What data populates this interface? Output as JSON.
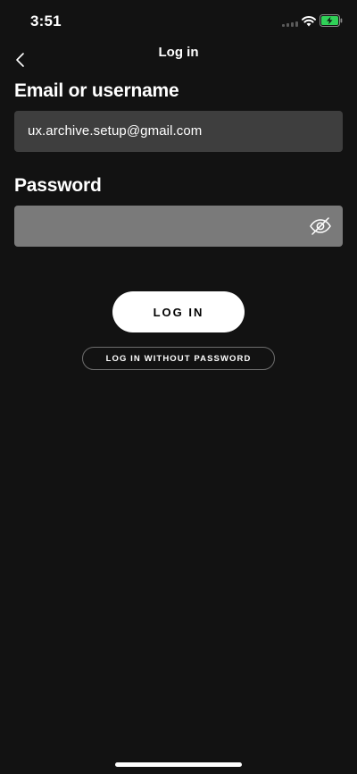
{
  "status_bar": {
    "time": "3:51",
    "icons": [
      "signal-icon",
      "wifi-icon",
      "battery-charging-icon"
    ],
    "battery_color": "#30d158"
  },
  "header": {
    "title": "Log in",
    "back_icon": "chevron-left-icon"
  },
  "form": {
    "email": {
      "label": "Email or username",
      "value": "ux.archive.setup@gmail.com"
    },
    "password": {
      "label": "Password",
      "value": "",
      "toggle_icon": "eye-slash-icon"
    }
  },
  "buttons": {
    "login": "LOG IN",
    "login_without_password": "LOG IN WITHOUT PASSWORD"
  },
  "colors": {
    "background": "#121212",
    "email_field": "#3e3e3e",
    "password_field": "#7a7a7a",
    "primary_button": "#ffffff"
  }
}
